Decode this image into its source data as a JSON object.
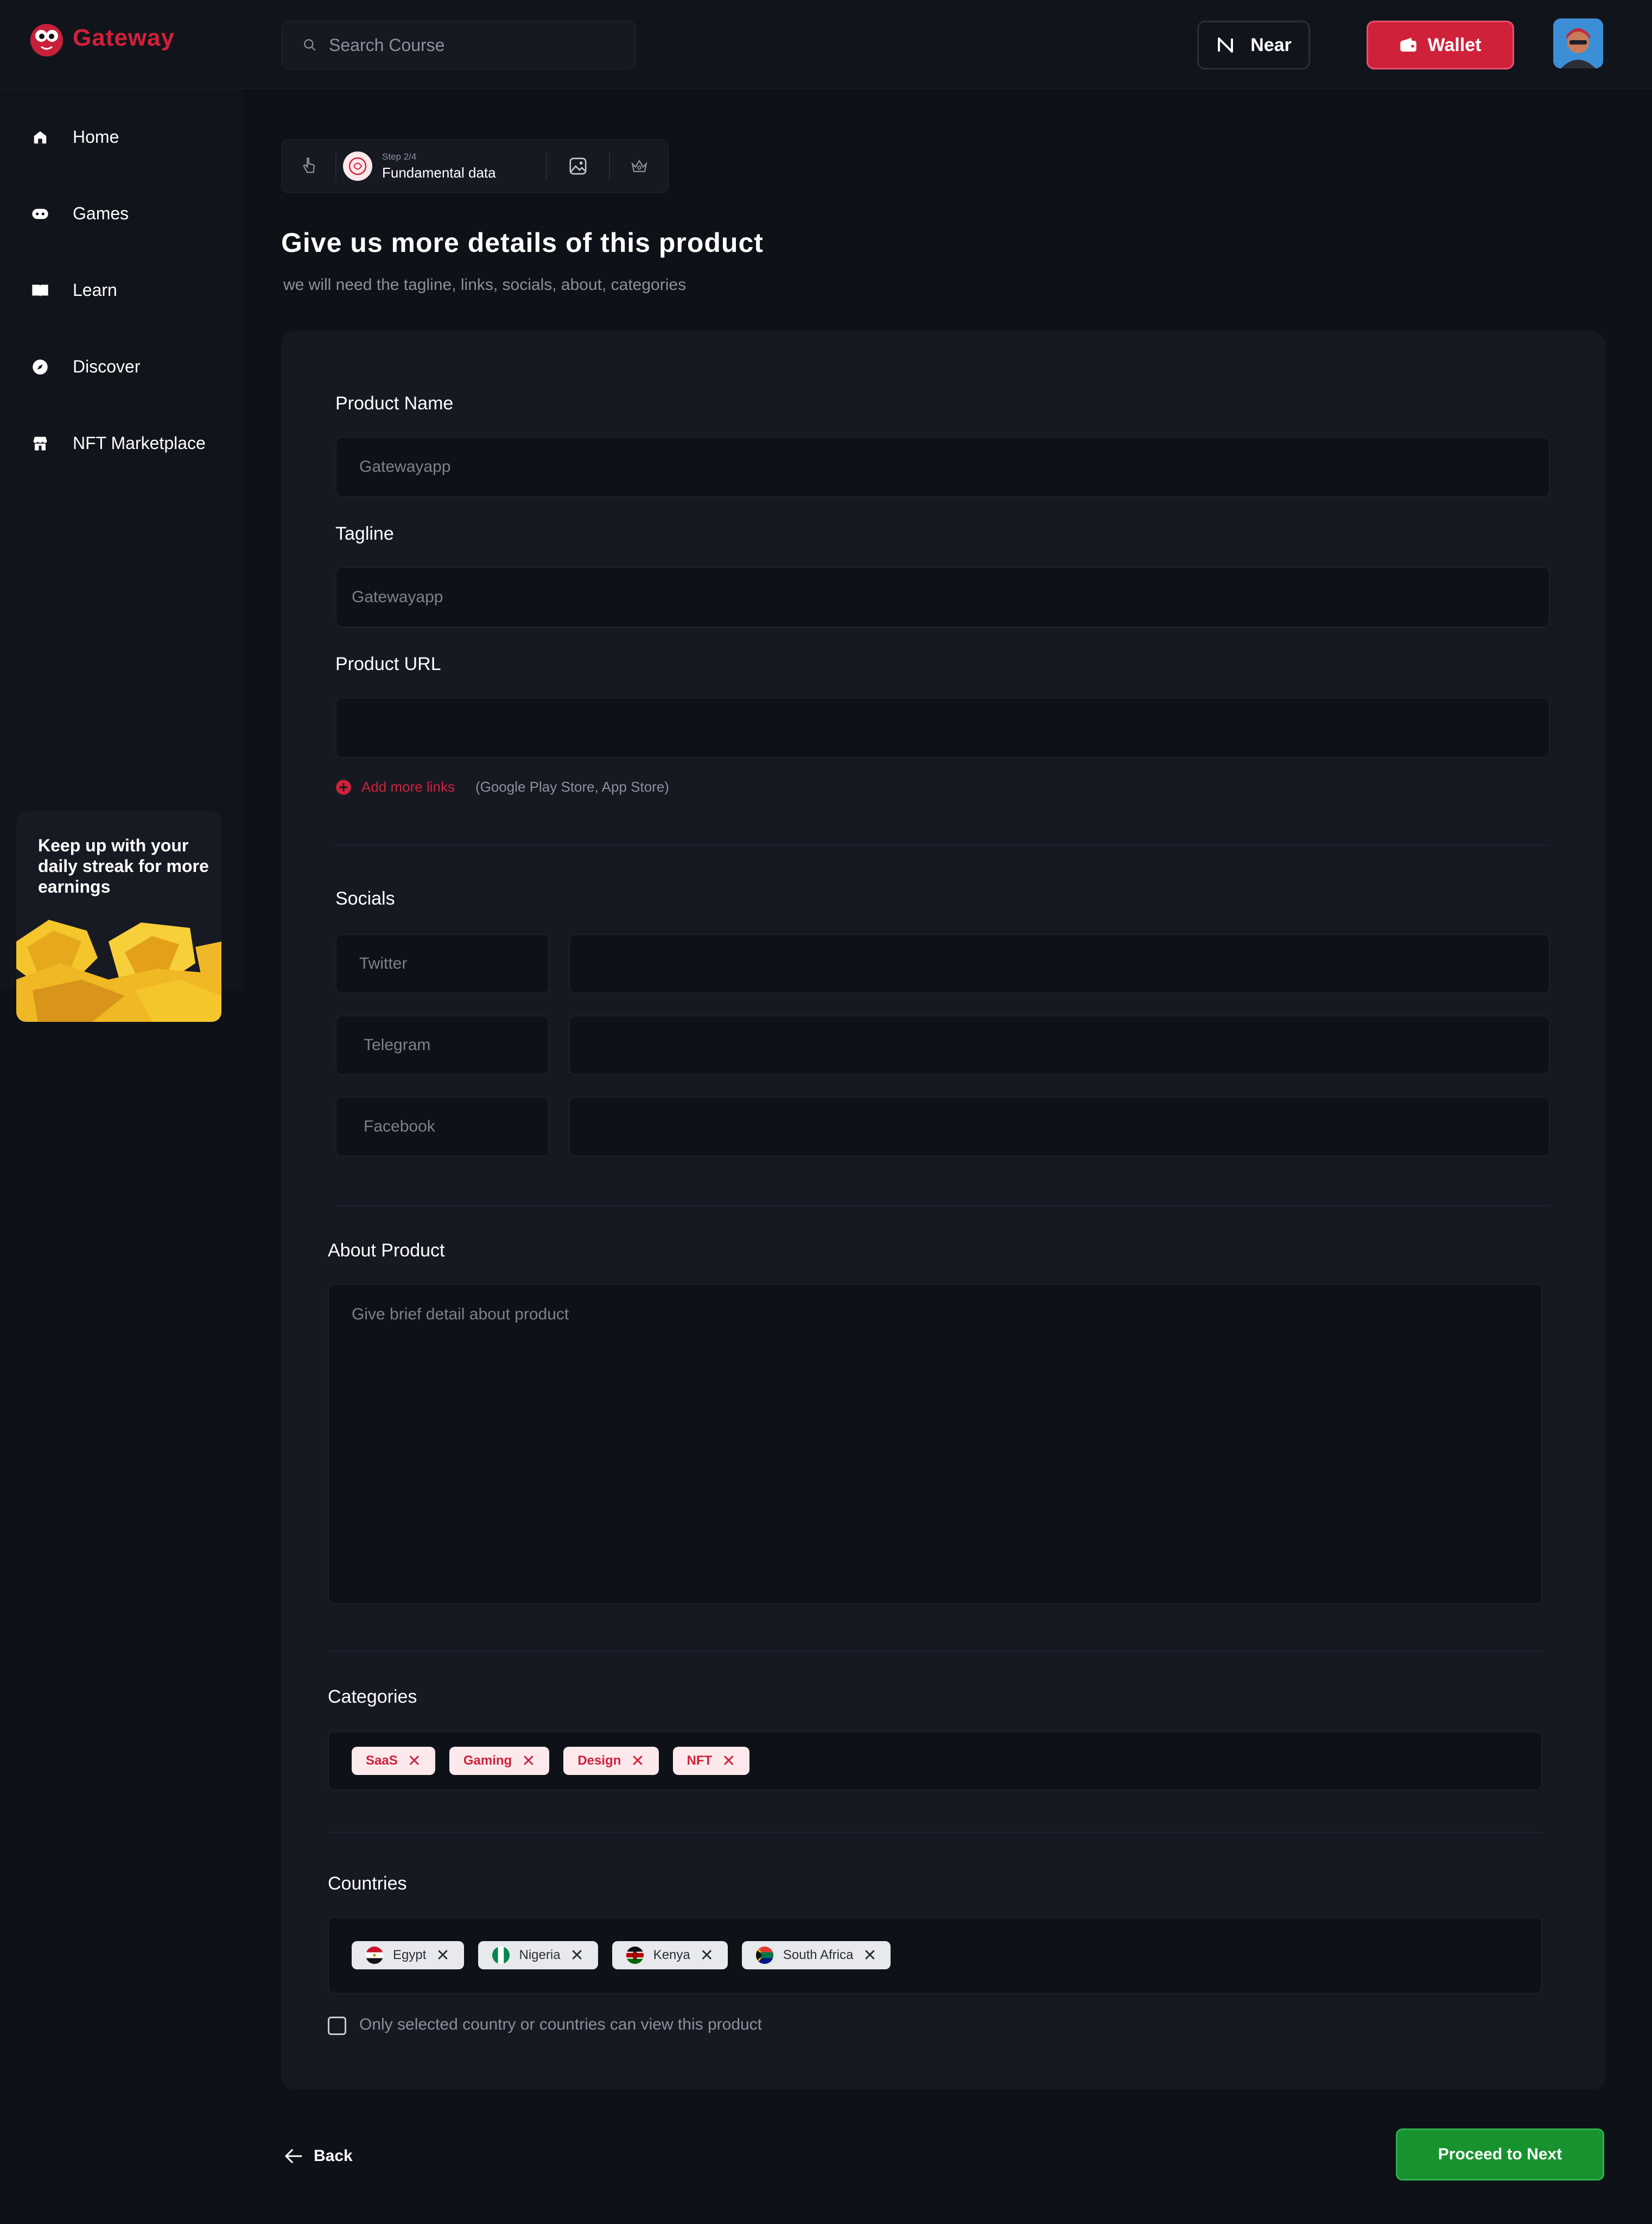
{
  "app": {
    "name": "Gateway"
  },
  "header": {
    "search_placeholder": "Search Course",
    "network_label": "Near",
    "wallet_label": "Wallet"
  },
  "sidebar": {
    "items": [
      {
        "label": "Home",
        "icon": "home-icon"
      },
      {
        "label": "Games",
        "icon": "gamepad-icon"
      },
      {
        "label": "Learn",
        "icon": "book-icon"
      },
      {
        "label": "Discover",
        "icon": "compass-icon"
      },
      {
        "label": "NFT Marketplace",
        "icon": "store-icon"
      }
    ],
    "promo_text": "Keep up with your daily streak for more earnings"
  },
  "stepper": {
    "step_label": "Step 2/4",
    "step_title": "Fundamental data",
    "icons": [
      "pointer-hand-icon",
      "product-logo-icon",
      "image-icon",
      "crown-icon"
    ]
  },
  "page": {
    "title": "Give us more details of this product",
    "subtitle": "we will need the tagline, links, socials, about, categories"
  },
  "form": {
    "product_name": {
      "label": "Product Name",
      "placeholder": "Gatewayapp"
    },
    "tagline": {
      "label": "Tagline",
      "placeholder": "Gatewayapp"
    },
    "product_url": {
      "label": "Product URL",
      "value": ""
    },
    "add_links": {
      "label": "Add more links",
      "hint": "(Google Play Store, App Store)"
    },
    "socials": {
      "label": "Socials",
      "rows": [
        {
          "name": "Twitter",
          "value": ""
        },
        {
          "name": "Telegram",
          "value": ""
        },
        {
          "name": "Facebook",
          "value": ""
        }
      ]
    },
    "about": {
      "label": "About Product",
      "placeholder": "Give brief detail about product"
    },
    "categories": {
      "label": "Categories",
      "chips": [
        "SaaS",
        "Gaming",
        "Design",
        "NFT"
      ]
    },
    "countries": {
      "label": "Countries",
      "chips": [
        "Egypt",
        "Nigeria",
        "Kenya",
        "South Africa"
      ]
    },
    "restrict_checkbox": {
      "label": "Only selected country or countries can view this product",
      "checked": false
    }
  },
  "footer": {
    "back_label": "Back",
    "proceed_label": "Proceed to Next"
  },
  "colors": {
    "background": "#0f1118",
    "panel": "#161922",
    "brand_red": "#d0213a",
    "proceed_green": "#17922f"
  }
}
